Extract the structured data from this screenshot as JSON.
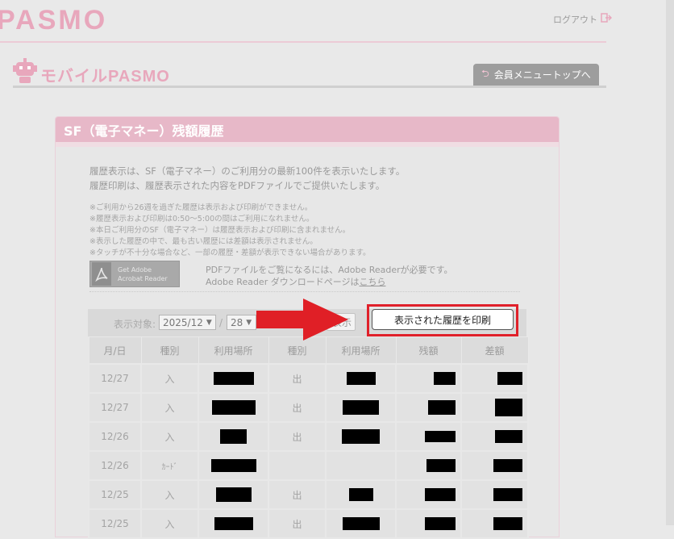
{
  "header": {
    "logo": "PASMO",
    "logout_label": "ログアウト",
    "mobile_logo": "モバイルPASMO",
    "member_menu_label": "会員メニュートップへ"
  },
  "panel": {
    "title": "SF（電子マネー）残額履歴",
    "intro": [
      "履歴表示は、SF（電子マネー）のご利用分の最新100件を表示いたします。",
      "履歴印刷は、履歴表示された内容をPDFファイルでご提供いたします。"
    ],
    "notes": [
      "※ご利用から26週を過ぎた履歴は表示および印刷ができません。",
      "※履歴表示および印刷は0:50～5:00の間はご利用になれません。",
      "※本日ご利用分のSF（電子マネー）は履歴表示および印刷に含まれません。",
      "※表示した履歴の中で、最も古い履歴には差額は表示されません。",
      "※タッチが不十分な場合など、一部の履歴・差額が表示できない場合があります。"
    ],
    "adobe": {
      "badge_line1": "Get Adobe",
      "badge_line2": "Acrobat Reader",
      "info_line1": "PDFファイルをご覧になるには、Adobe Readerが必要です。",
      "info_line2_prefix": "Adobe Reader ダウンロードページは",
      "info_link": "こちら"
    }
  },
  "filter": {
    "label": "表示対象:",
    "year_month": "2025/12",
    "day": "28",
    "slash": "/",
    "show_label": "表示",
    "print_label": "表示された履歴を印刷"
  },
  "table": {
    "headers": [
      "月/日",
      "種別",
      "利用場所",
      "種別",
      "利用場所",
      "残額",
      "差額"
    ],
    "rows": [
      {
        "date": "12/27",
        "type1": "入",
        "type2": "出"
      },
      {
        "date": "12/27",
        "type1": "入",
        "type2": "出"
      },
      {
        "date": "12/26",
        "type1": "入",
        "type2": "出"
      },
      {
        "date": "12/26",
        "type1": "ｶｰﾄﾞ",
        "type2": ""
      },
      {
        "date": "12/25",
        "type1": "入",
        "type2": "出"
      },
      {
        "date": "12/25",
        "type1": "入",
        "type2": "出"
      }
    ]
  },
  "colors": {
    "brand_pink": "#e8a7bc",
    "highlight_red": "#e0202a",
    "arrow_red": "#e01f26"
  },
  "icons": {
    "logout": "logout-arrow-icon",
    "member": "return-arrow-icon",
    "adobe": "adobe-pdf-icon",
    "chevron": "chevron-down-icon",
    "arrow": "red-arrow-right-icon"
  }
}
